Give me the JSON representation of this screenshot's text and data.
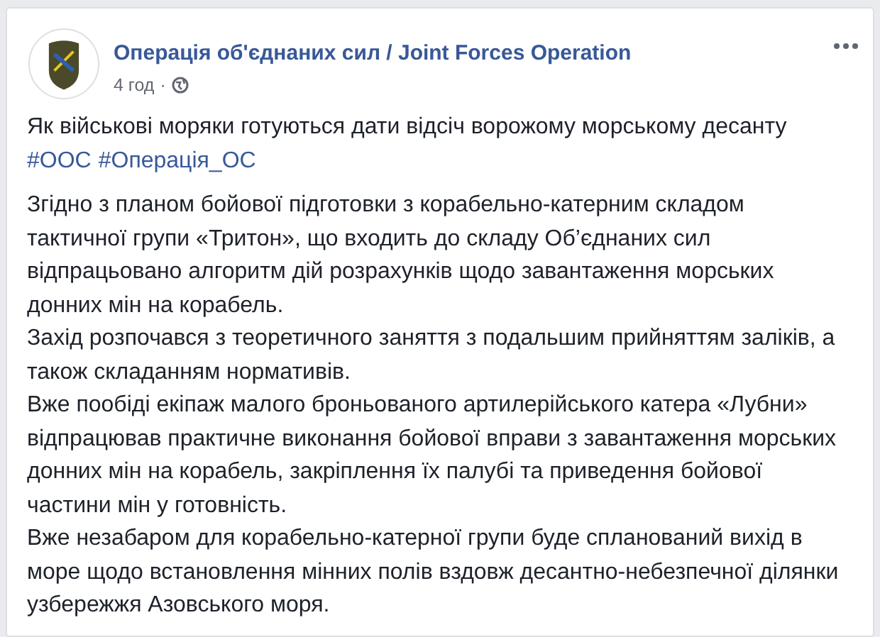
{
  "post": {
    "author": "Операція об'єднаних сил / Joint Forces Operation",
    "time": "4 год",
    "separator": "·",
    "headline": "Як військові моряки готуються дати відсіч ворожому морському десанту",
    "hashtags": [
      "#ООС",
      "#Операція_ОС"
    ],
    "paragraphs": [
      "Згідно з планом бойової підготовки з корабельно-катерним складом тактичної групи «Тритон», що входить до складу Об’єднаних сил відпрацьовано алгоритм дій розрахунків щодо завантаження морських донних мін на корабель.",
      "Захід розпочався з теоретичного заняття з подальшим прийняттям заліків, а також складанням нормативів.",
      "Вже пообіді екіпаж малого броньованого артилерійського катера «Лубни» відпрацював практичне виконання бойової вправи з завантаження морських донних мін на корабель, закріплення їх палубі та приведення бойової частини мін у готовність.",
      "Вже незабаром для корабельно-катерної групи буде спланований вихід в море щодо встановлення мінних полів вздовж десантно-небезпечної ділянки узбережжя Азовського моря."
    ]
  }
}
